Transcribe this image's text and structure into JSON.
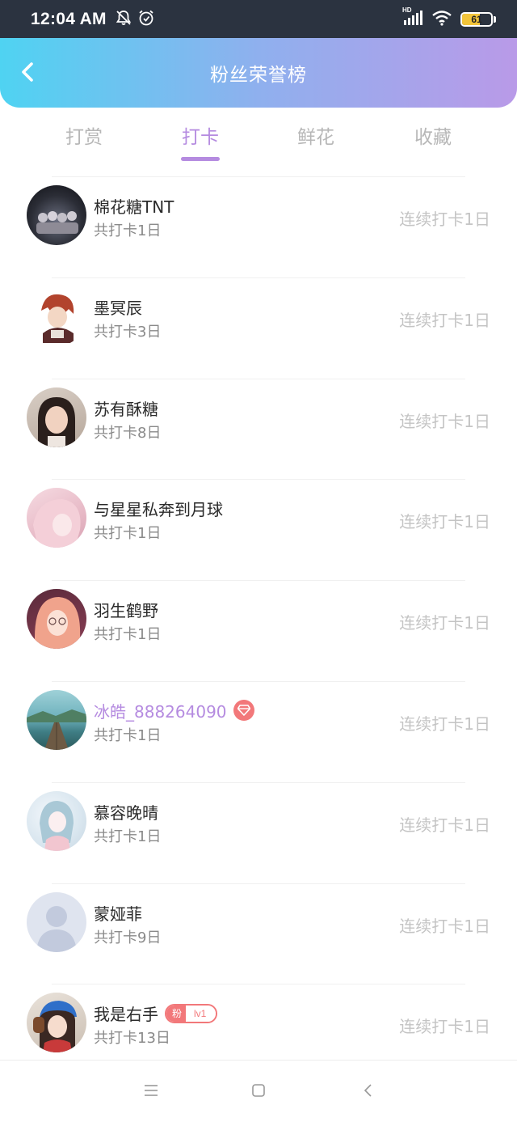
{
  "status_bar": {
    "time": "12:04 AM",
    "network_label": "HD",
    "battery_level": "61",
    "battery_fraction": 0.61
  },
  "header": {
    "title": "粉丝荣誉榜",
    "back_icon": "chevron-left-icon"
  },
  "tabs": [
    {
      "label": "打赏",
      "active": false
    },
    {
      "label": "打卡",
      "active": true
    },
    {
      "label": "鲜花",
      "active": false
    },
    {
      "label": "收藏",
      "active": false
    }
  ],
  "accent_color": "#b58be0",
  "list": [
    {
      "name": "棉花糖TNT",
      "total": "共打卡1日",
      "streak": "连续打卡1日"
    },
    {
      "name": "墨冥辰",
      "total": "共打卡3日",
      "streak": "连续打卡1日"
    },
    {
      "name": "苏有酥糖",
      "total": "共打卡8日",
      "streak": "连续打卡1日"
    },
    {
      "name": "与星星私奔到月球",
      "total": "共打卡1日",
      "streak": "连续打卡1日"
    },
    {
      "name": "羽生鹤野",
      "total": "共打卡1日",
      "streak": "连续打卡1日"
    },
    {
      "name": "冰皓_888264090",
      "total": "共打卡1日",
      "streak": "连续打卡1日",
      "badge": "gem-icon"
    },
    {
      "name": "慕容晚晴",
      "total": "共打卡1日",
      "streak": "连续打卡1日"
    },
    {
      "name": "蒙娅菲",
      "total": "共打卡9日",
      "streak": "连续打卡1日"
    },
    {
      "name": "我是右手",
      "total": "共打卡13日",
      "streak": "连续打卡1日",
      "fan_badge": {
        "left": "粉",
        "right": "lv1"
      }
    }
  ],
  "nav": {
    "menu_icon": "menu-icon",
    "home_icon": "home-square-icon",
    "back_icon": "back-triangle-icon"
  }
}
